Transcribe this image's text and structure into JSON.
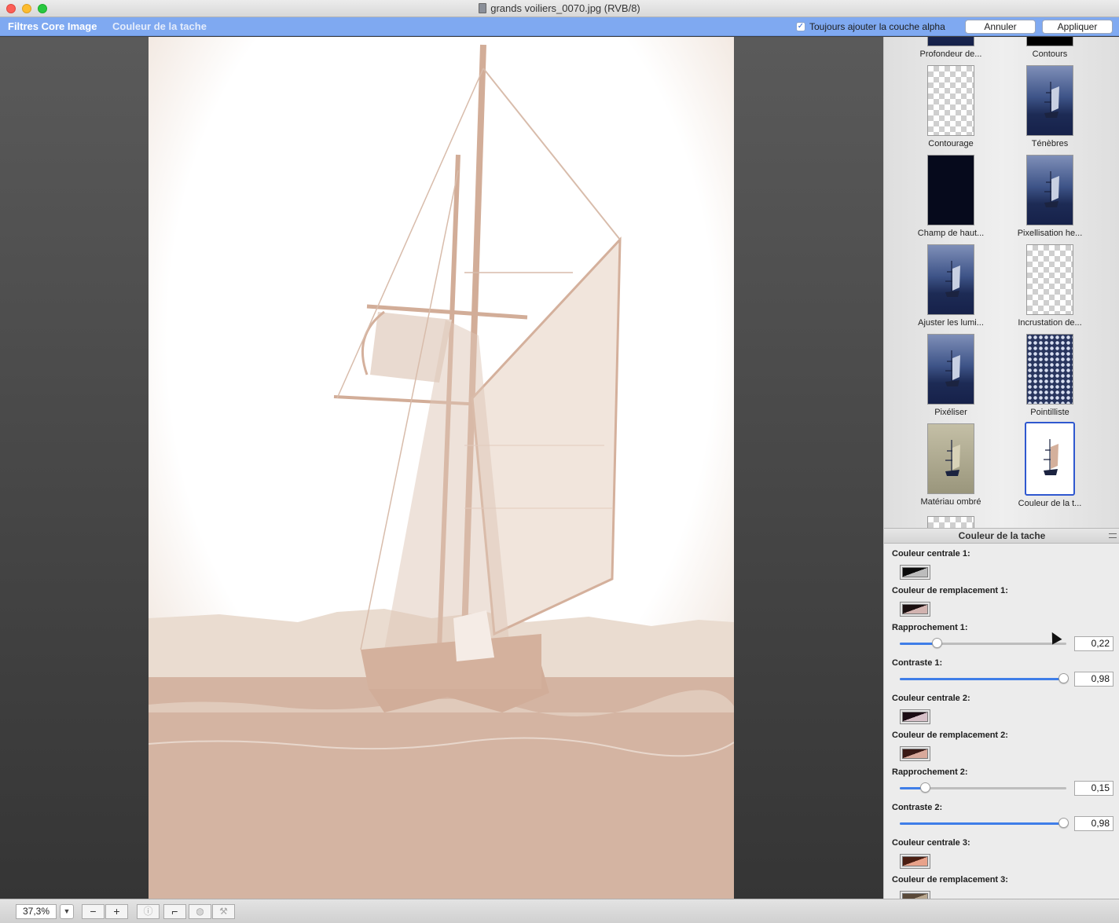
{
  "window": {
    "title": "grands voiliers_0070.jpg (RVB/8)"
  },
  "toolbar": {
    "app_label": "Filtres Core Image",
    "filter_label": "Couleur de la tache",
    "alpha_checkbox_label": "Toujours ajouter la couche alpha",
    "alpha_checked": true,
    "cancel_label": "Annuler",
    "apply_label": "Appliquer"
  },
  "thumbnails": [
    {
      "label": "Profondeur de...",
      "style": "sea",
      "partial": true
    },
    {
      "label": "Contours",
      "style": "black",
      "partial": true
    },
    {
      "label": "Contourage",
      "style": "checker"
    },
    {
      "label": "Ténèbres",
      "style": "sea"
    },
    {
      "label": "Champ de haut...",
      "style": "dark"
    },
    {
      "label": "Pixellisation he...",
      "style": "sea"
    },
    {
      "label": "Ajuster les lumi...",
      "style": "sea"
    },
    {
      "label": "Incrustation de...",
      "style": "checker"
    },
    {
      "label": "Pixéliser",
      "style": "sea"
    },
    {
      "label": "Pointilliste",
      "style": "dots"
    },
    {
      "label": "Matériau ombré",
      "style": "tan"
    },
    {
      "label": "Couleur de la t...",
      "style": "sepia",
      "selected": true
    }
  ],
  "params_panel": {
    "title": "Couleur de la tache",
    "params": [
      {
        "type": "color",
        "label": "Couleur centrale 1:",
        "c1": "#0b0b0b",
        "c2": "#bcbcbc"
      },
      {
        "type": "color",
        "label": "Couleur de remplacement 1:",
        "c1": "#1a0f10",
        "c2": "#d2b3b0"
      },
      {
        "type": "slider",
        "label": "Rapprochement 1:",
        "value": 0.22,
        "display": "0,22"
      },
      {
        "type": "slider",
        "label": "Contraste 1:",
        "value": 0.98,
        "display": "0,98"
      },
      {
        "type": "color",
        "label": "Couleur centrale 2:",
        "c1": "#1a0c14",
        "c2": "#d6c0c8"
      },
      {
        "type": "color",
        "label": "Couleur de remplacement 2:",
        "c1": "#3a1a16",
        "c2": "#d9a99b"
      },
      {
        "type": "slider",
        "label": "Rapprochement 2:",
        "value": 0.15,
        "display": "0,15"
      },
      {
        "type": "slider",
        "label": "Contraste 2:",
        "value": 0.98,
        "display": "0,98"
      },
      {
        "type": "color",
        "label": "Couleur centrale 3:",
        "c1": "#4a1e12",
        "c2": "#e8a28a"
      },
      {
        "type": "color",
        "label": "Couleur de remplacement 3:",
        "c1": "#5a4a3a",
        "c2": "#b9a890"
      }
    ]
  },
  "bottom": {
    "zoom": "37,3%"
  },
  "colors": {
    "accent": "#7fa9f1",
    "image_sepia": "#d2b3a1"
  }
}
